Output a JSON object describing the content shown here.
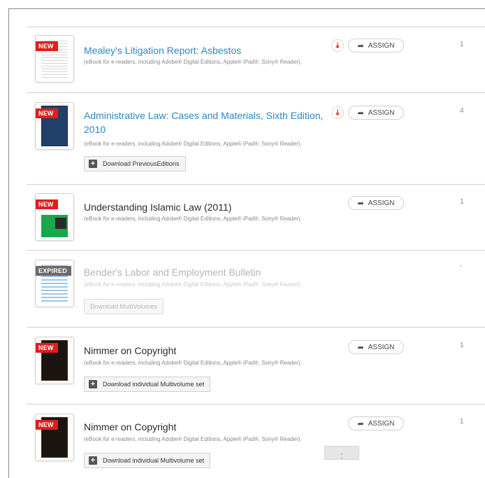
{
  "rows": [
    {
      "badge": "NEW",
      "title": "Mealey's Litigation Report: Asbestos",
      "subtitle": "(eBook for e-readers, including Adobe® Digital Editions, Apple® iPad®, Sony® Reader).",
      "assign": "ASSIGN",
      "download_icon": "download-icon",
      "count": "1"
    },
    {
      "badge": "NEW",
      "title": "Administrative Law: Cases and Materials, Sixth Edition, 2010",
      "subtitle": "(eBook for e-readers, including Adobe® Digital Editions, Apple® iPad®, Sony® Reader).",
      "assign": "ASSIGN",
      "download_icon": "download-icon",
      "count": "4",
      "button": "Download PreviousEditions"
    },
    {
      "badge": "NEW",
      "title": "Understanding Islamic Law (2011)",
      "subtitle": "(eBook for e-readers, including Adobe® Digital Editions, Apple® iPad®, Sony® Reader).",
      "assign": "ASSIGN",
      "count": "1"
    },
    {
      "badge": "EXPIRED",
      "title": "Bender's Labor and Employment Bulletin",
      "subtitle": "(eBook for e-readers, including Adobe® Digital Editions, Apple® iPad®, Sony® Reader).",
      "count": "-",
      "button": "Download MultiVolumes"
    },
    {
      "badge": "NEW",
      "title": "Nimmer on Copyright",
      "subtitle": "(eBook for e-readers, including Adobe® Digital Editions, Apple® iPad®, Sony® Reader).",
      "assign": "ASSIGN",
      "count": "1",
      "button": "Download individual Multivolume set"
    },
    {
      "badge": "NEW",
      "title": "Nimmer on Copyright",
      "subtitle": "(eBook for e-readers, including Adobe® Digital Editions, Apple® iPad®, Sony® Reader).",
      "assign": "ASSIGN",
      "count": "1",
      "button": "Download individual Multivolume set"
    }
  ],
  "colors": {
    "link": "#2a88c6",
    "badge_new": "#e01e1e",
    "badge_expired": "#6a6a6a"
  },
  "icons": {
    "assign": "share-arrow-icon",
    "download": "download-icon",
    "plus": "plus-icon",
    "scroll_top": "double-chevron-up-icon"
  }
}
